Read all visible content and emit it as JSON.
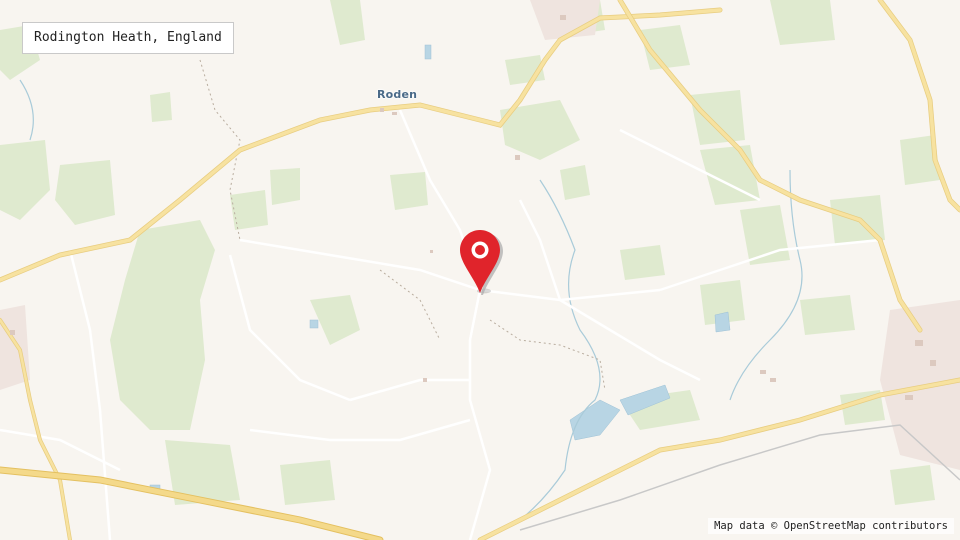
{
  "map": {
    "place_title": "Rodington Heath, England",
    "town_label": "Roden",
    "attribution": "Map data © OpenStreetMap contributors"
  },
  "colors": {
    "background": "#f8f5f0",
    "woodland": "#dbe8cd",
    "road": "#f6dd8f",
    "water": "#b6d3e3",
    "pin": "#e0242b"
  },
  "icons": {
    "pin": "map-pin-icon"
  }
}
